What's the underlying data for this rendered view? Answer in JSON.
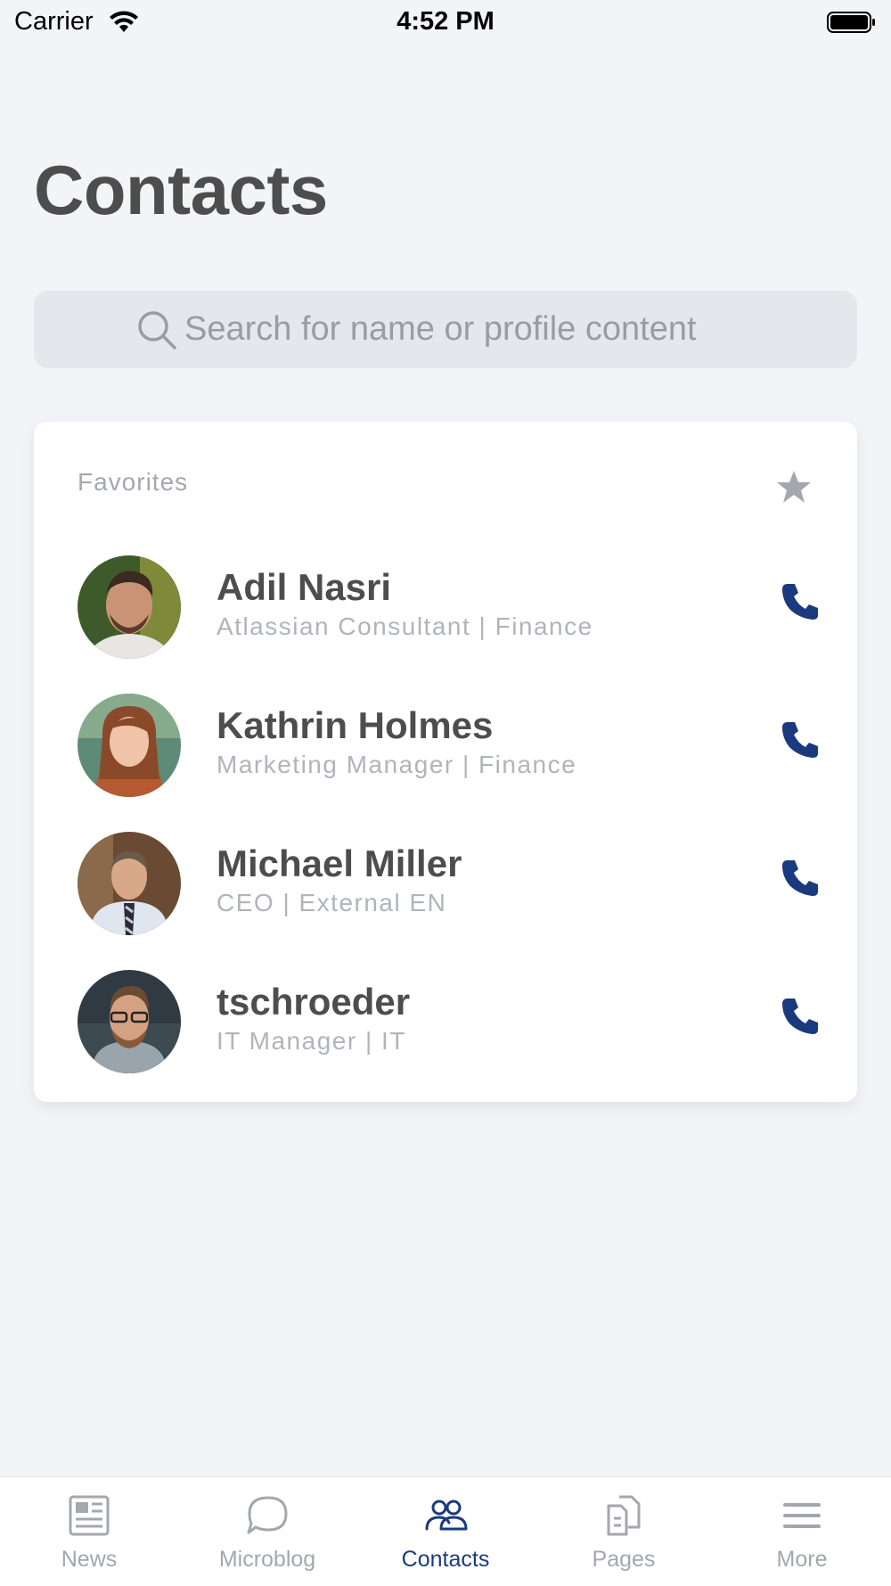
{
  "status_bar": {
    "carrier": "Carrier",
    "time": "4:52 PM"
  },
  "page": {
    "title": "Contacts"
  },
  "search": {
    "placeholder": "Search for name or profile content",
    "value": ""
  },
  "favorites": {
    "header": "Favorites",
    "contacts": [
      {
        "name": "Adil Nasri",
        "subtitle": "Atlassian Consultant | Finance"
      },
      {
        "name": "Kathrin Holmes",
        "subtitle": "Marketing Manager | Finance"
      },
      {
        "name": "Michael Miller",
        "subtitle": "CEO | External EN"
      },
      {
        "name": "tschroeder",
        "subtitle": "IT Manager | IT"
      }
    ]
  },
  "tabs": [
    {
      "label": "News",
      "icon": "news-icon",
      "active": false
    },
    {
      "label": "Microblog",
      "icon": "chat-bubble-icon",
      "active": false
    },
    {
      "label": "Contacts",
      "icon": "people-icon",
      "active": true
    },
    {
      "label": "Pages",
      "icon": "pages-icon",
      "active": false
    },
    {
      "label": "More",
      "icon": "menu-icon",
      "active": false
    }
  ],
  "colors": {
    "accent": "#1b3a7e",
    "background": "#f3f4f8",
    "title_text": "#4d4d4d",
    "secondary_text": "#a4a7ae"
  }
}
